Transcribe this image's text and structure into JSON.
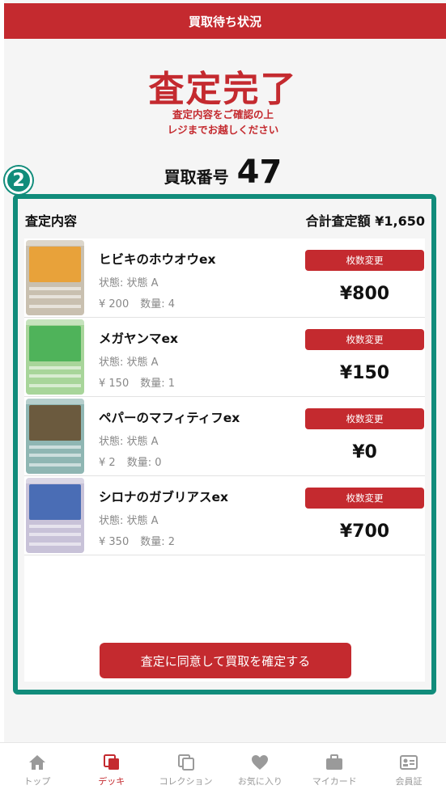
{
  "header": {
    "title": "買取待ち状況"
  },
  "status": {
    "title": "査定完了",
    "subtitle_line1": "査定内容をご確認の上",
    "subtitle_line2": "レジまでお越しください"
  },
  "purchase_number": {
    "label": "買取番号",
    "value": "47"
  },
  "step_badge": "2",
  "summary": {
    "left_label": "査定内容",
    "total_label": "合計査定額 ¥1,650"
  },
  "change_button_label": "枚数変更",
  "cards": [
    {
      "name": "ヒビキのホウオウex",
      "condition": "状態: 状態 A",
      "unit_price": "¥ 200",
      "quantity": "数量: 4",
      "price": "¥800",
      "art_color": "#e8a23a",
      "bg_color": "#c9c0b0"
    },
    {
      "name": "メガヤンマex",
      "condition": "状態: 状態 A",
      "unit_price": "¥ 150",
      "quantity": "数量: 1",
      "price": "¥150",
      "art_color": "#4fb35a",
      "bg_color": "#a8d59a"
    },
    {
      "name": "ペパーのマフィティフex",
      "condition": "状態: 状態 A",
      "unit_price": "¥ 2",
      "quantity": "数量: 0",
      "price": "¥0",
      "art_color": "#6b5a3e",
      "bg_color": "#8fb6b3"
    },
    {
      "name": "シロナのガブリアスex",
      "condition": "状態: 状態 A",
      "unit_price": "¥ 350",
      "quantity": "数量: 2",
      "price": "¥700",
      "art_color": "#4a6db5",
      "bg_color": "#c8c2d8"
    }
  ],
  "confirm_button_label": "査定に同意して買取を確定する",
  "tabs": [
    {
      "label": "トップ",
      "icon": "home-icon",
      "active": false
    },
    {
      "label": "デッキ",
      "icon": "deck-icon",
      "active": true
    },
    {
      "label": "コレクション",
      "icon": "collection-icon",
      "active": false
    },
    {
      "label": "お気に入り",
      "icon": "heart-icon",
      "active": false
    },
    {
      "label": "マイカード",
      "icon": "briefcase-icon",
      "active": false
    },
    {
      "label": "会員証",
      "icon": "member-card-icon",
      "active": false
    }
  ],
  "colors": {
    "brand": "#c42a2f",
    "highlight": "#118c7b"
  }
}
